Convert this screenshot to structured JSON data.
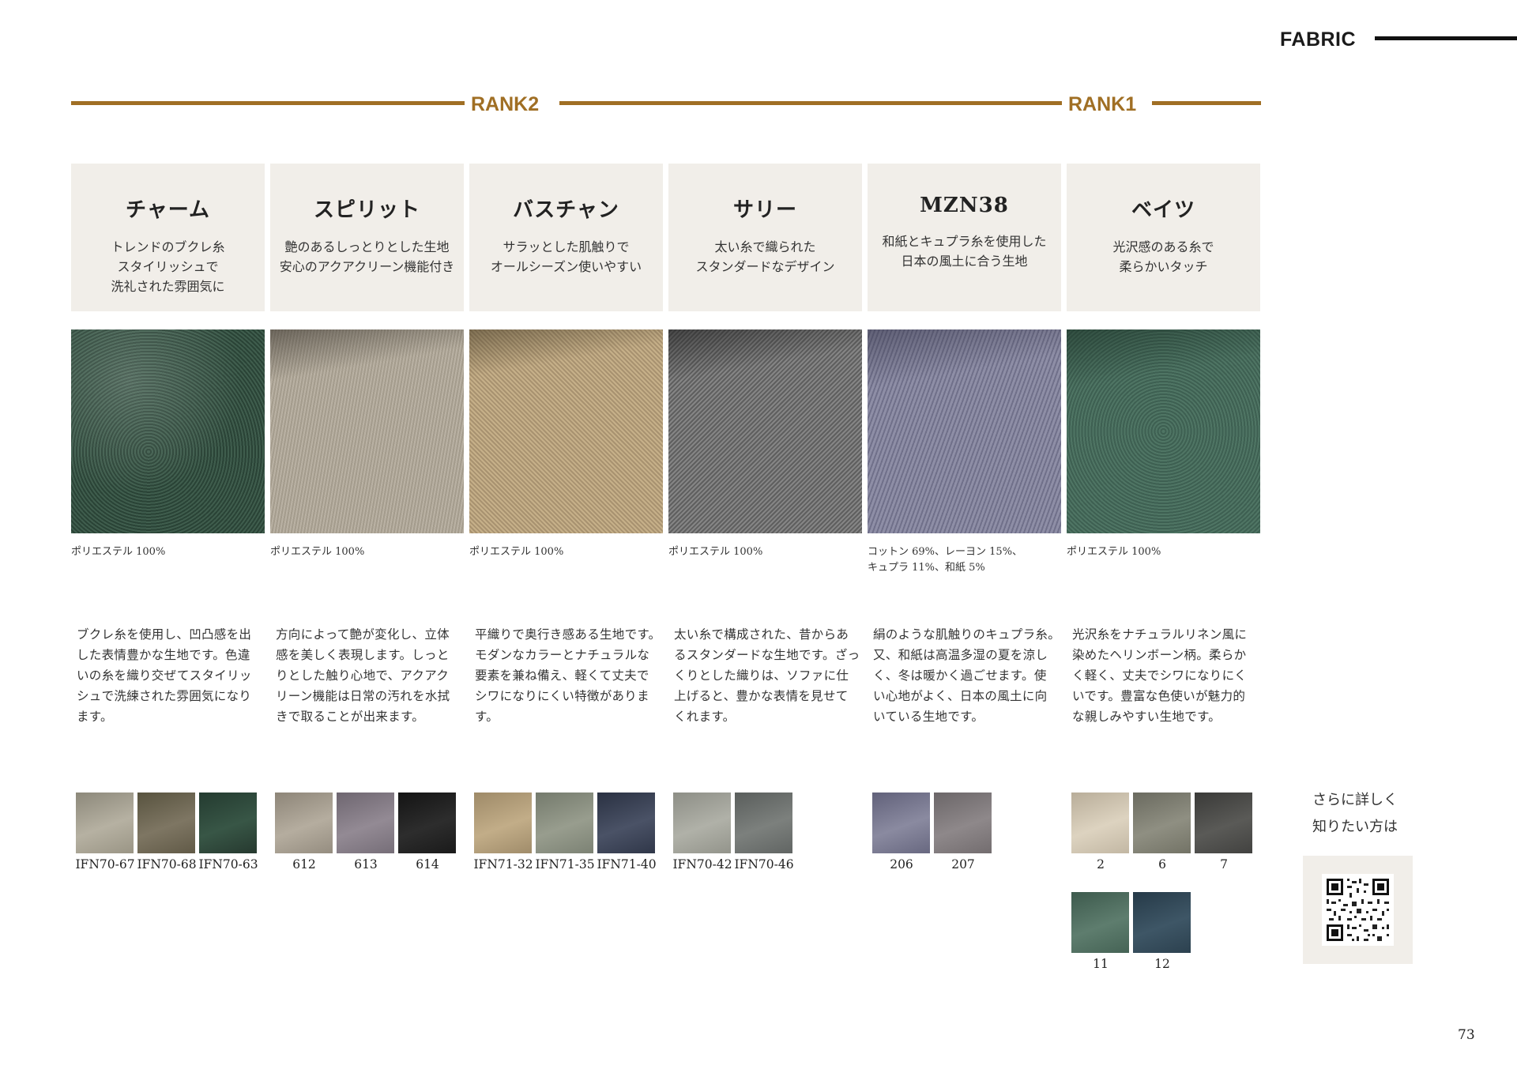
{
  "header": {
    "title": "FABRIC"
  },
  "ranks": [
    {
      "label": "RANK2"
    },
    {
      "label": "RANK1"
    }
  ],
  "fabrics": [
    {
      "name": "チャーム",
      "tagline": [
        "トレンドのブクレ糸",
        "スタイリッシュで",
        "洗礼された雰囲気に"
      ],
      "material": [
        "ポリエステル 100%"
      ],
      "description": [
        "ブクレ糸を使用し、凹凸感を出",
        "した表情豊かな生地です。色違",
        "いの糸を織り交ぜてスタイリッ",
        "シュで洗練された雰囲気になり",
        "ます。"
      ],
      "colors": [
        {
          "code": "IFN70-67"
        },
        {
          "code": "IFN70-68"
        },
        {
          "code": "IFN70-63"
        }
      ]
    },
    {
      "name": "スピリット",
      "tagline": [
        "艶のあるしっとりとした生地",
        "安心のアクアクリーン機能付き"
      ],
      "material": [
        "ポリエステル 100%"
      ],
      "description": [
        "方向によって艶が変化し、立体",
        "感を美しく表現します。しっと",
        "りとした触り心地で、アクアク",
        "リーン機能は日常の汚れを水拭",
        "きで取ることが出来ます。"
      ],
      "colors": [
        {
          "code": "612"
        },
        {
          "code": "613"
        },
        {
          "code": "614"
        }
      ]
    },
    {
      "name": "バスチャン",
      "tagline": [
        "サラッとした肌触りで",
        "オールシーズン使いやすい"
      ],
      "material": [
        "ポリエステル 100%"
      ],
      "description": [
        "平織りで奥行き感ある生地です。",
        "モダンなカラーとナチュラルな",
        "要素を兼ね備え、軽くて丈夫で",
        "シワになりにくい特徴がありま",
        "す。"
      ],
      "colors": [
        {
          "code": "IFN71-32"
        },
        {
          "code": "IFN71-35"
        },
        {
          "code": "IFN71-40"
        }
      ]
    },
    {
      "name": "サリー",
      "tagline": [
        "太い糸で織られた",
        "スタンダードなデザイン"
      ],
      "material": [
        "ポリエステル 100%"
      ],
      "description": [
        "太い糸で構成された、昔からあ",
        "るスタンダードな生地です。ざっ",
        "くりとした織りは、ソファに仕",
        "上げると、豊かな表情を見せて",
        "くれます。"
      ],
      "colors": [
        {
          "code": "IFN70-42"
        },
        {
          "code": "IFN70-46"
        }
      ]
    },
    {
      "name": "MZN38",
      "tagline": [
        "和紙とキュプラ糸を使用した",
        "日本の風土に合う生地"
      ],
      "material": [
        "コットン 69%、レーヨン 15%、",
        "キュプラ 11%、和紙 5%"
      ],
      "description": [
        "絹のような肌触りのキュプラ糸。",
        "又、和紙は高温多湿の夏を涼し",
        "く、冬は暖かく過ごせます。使",
        "い心地がよく、日本の風土に向",
        "いている生地です。"
      ],
      "colors": [
        {
          "code": "206"
        },
        {
          "code": "207"
        }
      ]
    },
    {
      "name": "ベイツ",
      "tagline": [
        "光沢感のある糸で",
        "柔らかいタッチ"
      ],
      "material": [
        "ポリエステル 100%"
      ],
      "description": [
        "光沢糸をナチュラルリネン風に",
        "染めたヘリンボーン柄。柔らか",
        "く軽く、丈夫でシワになりにく",
        "いです。豊富な色使いが魅力的",
        "な親しみやすい生地です。"
      ],
      "colors": [
        {
          "code": "2"
        },
        {
          "code": "6"
        },
        {
          "code": "7"
        },
        {
          "code": "11"
        },
        {
          "code": "12"
        }
      ]
    }
  ],
  "more": {
    "lines": [
      "さらに詳しく",
      "知りたい方は"
    ]
  },
  "page_number": "73",
  "colors": {
    "accent": "#a06f24",
    "panel": "#f1eee9"
  }
}
